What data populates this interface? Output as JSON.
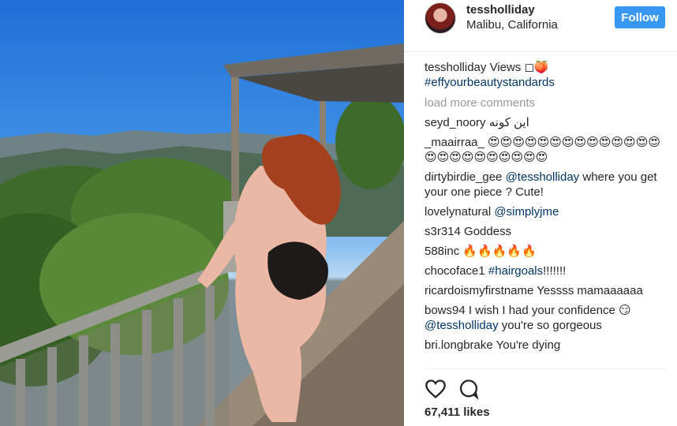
{
  "post": {
    "username": "tessholliday",
    "location": "Malibu, California",
    "follow_label": "Follow",
    "likes": "67,411 likes"
  },
  "caption": {
    "user": "tessholliday",
    "text": "Views ◻🍑",
    "hashtag": "#effyourbeautystandards"
  },
  "load_more": "load more comments",
  "comments": [
    {
      "user": "seyd_noory",
      "text": "این کونه"
    },
    {
      "user": "_maairraa_",
      "text": "😍😍😍😍😍😍😍😍😍😍😍😍😍😍😍😍😍😍😍😍😍😍😍😍"
    },
    {
      "user": "dirtybirdie_gee",
      "mention": "@tessholliday",
      "text": " where you get your one piece ? Cute!"
    },
    {
      "user": "lovelynatural",
      "mention": "@simplyjme",
      "text": ""
    },
    {
      "user": "s3r314",
      "text": "Goddess"
    },
    {
      "user": "588inc",
      "text": "🔥🔥🔥🔥🔥"
    },
    {
      "user": "chocoface1",
      "mention": "#hairgoals",
      "text": "!!!!!!!"
    },
    {
      "user": "ricardoismyfirstname",
      "text": "Yessss mamaaaaaa"
    },
    {
      "user": "bows94",
      "text": "I wish I had your confidence 😏 ",
      "mention": "@tessholliday",
      "text2": " you're so gorgeous"
    },
    {
      "user": "bri.longbrake",
      "text": "You're dying"
    }
  ],
  "icons": {
    "heart": "heart-icon",
    "comment": "comment-icon"
  }
}
